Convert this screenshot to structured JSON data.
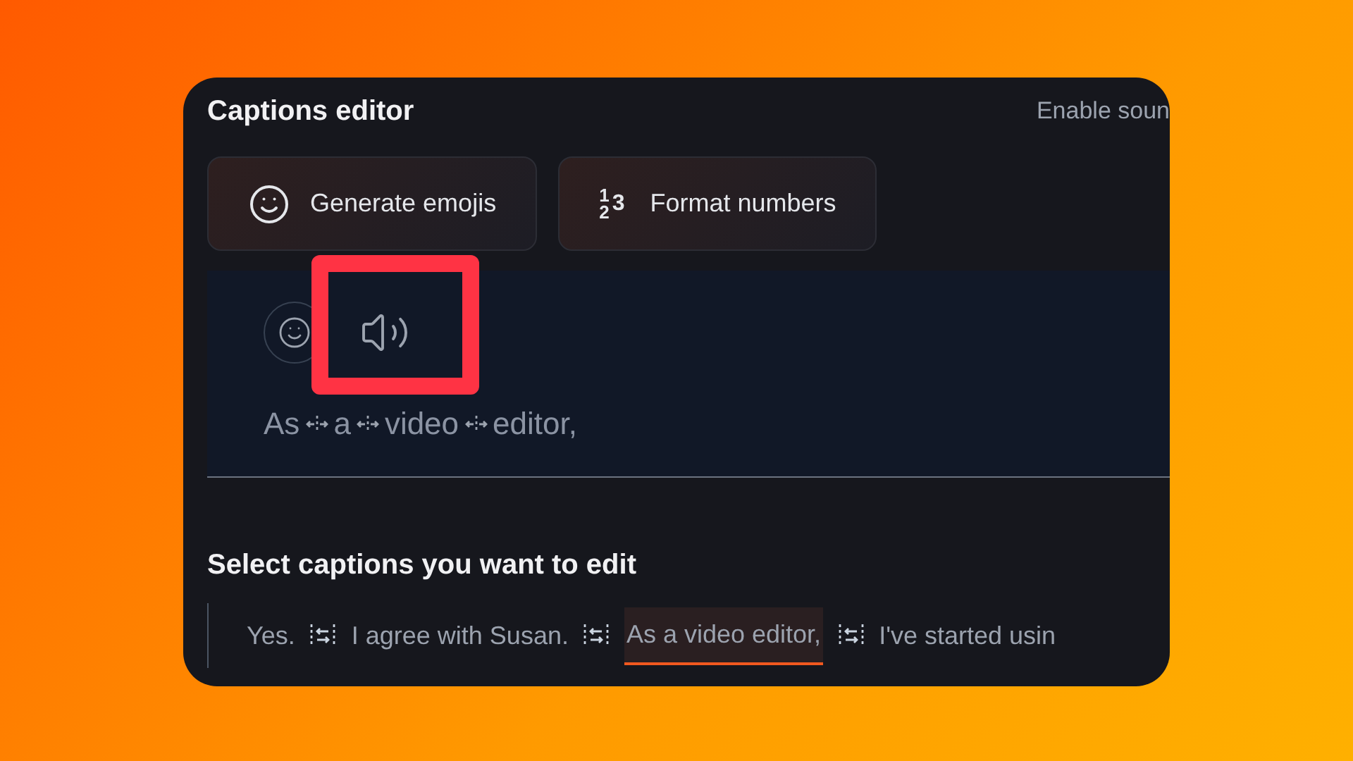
{
  "panel": {
    "title": "Captions editor",
    "sound_label": "Enable soun"
  },
  "actions": [
    {
      "kind": "emoji",
      "label": "Generate emojis"
    },
    {
      "kind": "numbers",
      "label": "Format numbers",
      "glyph": [
        "1",
        "2",
        "3"
      ]
    }
  ],
  "preview": {
    "speaker_highlighted": true,
    "words": [
      "As",
      "a",
      "video",
      "editor,"
    ]
  },
  "captions_section": {
    "heading": "Select captions you want to edit",
    "captions": [
      {
        "text": "Yes.",
        "selected": false
      },
      {
        "text": "I agree with Susan.",
        "selected": false
      },
      {
        "text": "As a video editor,",
        "selected": true
      },
      {
        "text": "I've started usin",
        "selected": false
      }
    ]
  }
}
